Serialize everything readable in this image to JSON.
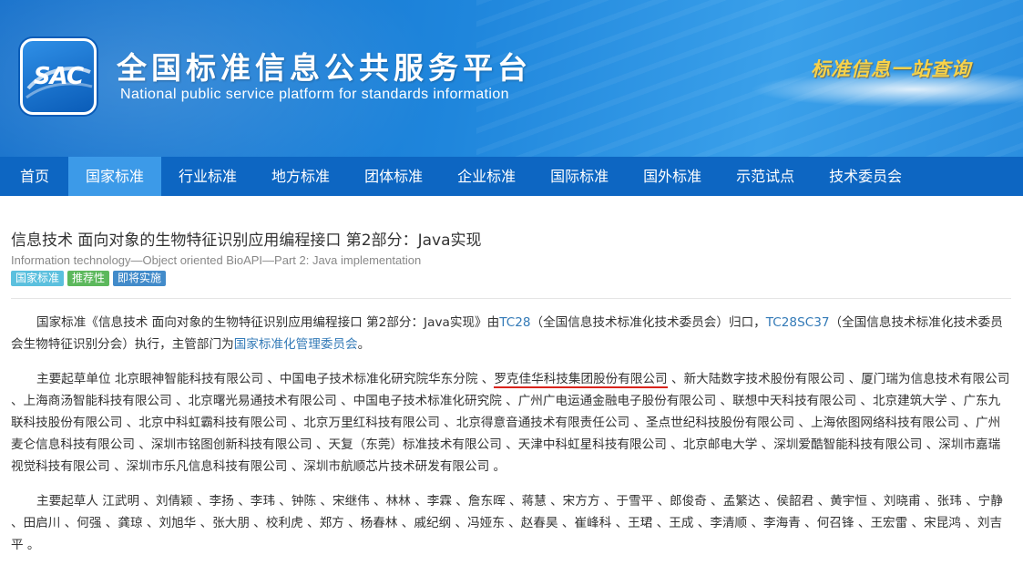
{
  "banner": {
    "logo_text": "SAC",
    "title_cn": "全国标准信息公共服务平台",
    "title_en": "National public service platform  for standards information",
    "slogan": "标准信息一站查询"
  },
  "nav": [
    "首页",
    "国家标准",
    "行业标准",
    "地方标准",
    "团体标准",
    "企业标准",
    "国际标准",
    "国外标准",
    "示范试点",
    "技术委员会"
  ],
  "standard": {
    "title_cn": "信息技术 面向对象的生物特征识别应用编程接口 第2部分：Java实现",
    "title_en": "Information technology—Object oriented BioAPI—Part 2: Java implementation",
    "badges": [
      "国家标准",
      "推荐性",
      "即将实施"
    ],
    "intro": {
      "p1": "国家标准《信息技术 面向对象的生物特征识别应用编程接口 第2部分：Java实现》由",
      "tc": "TC28",
      "p2": "（全国信息技术标准化技术委员会）归口，",
      "sc": "TC28SC37",
      "p3": "（全国信息技术标准化技术委员会生物特征识别分会）执行，主管部门为",
      "dept": "国家标准化管理委员会",
      "p4": "。"
    },
    "drafting_units": {
      "lead": "主要起草单位 北京眼神智能科技有限公司 、中国电子技术标准化研究院华东分院 、",
      "highlight": "罗克佳华科技集团股份有限公司",
      "rest": " 、新大陆数字技术股份有限公司 、厦门瑞为信息技术有限公司 、上海商汤智能科技有限公司 、北京曙光易通技术有限公司 、中国电子技术标准化研究院 、广州广电运通金融电子股份有限公司 、联想中天科技有限公司 、北京建筑大学 、广东九联科技股份有限公司 、北京中科虹霸科技有限公司 、北京万里红科技有限公司 、北京得意音通技术有限责任公司 、圣点世纪科技股份有限公司 、上海依图网络科技有限公司 、广州麦仑信息科技有限公司 、深圳市铭图创新科技有限公司 、天复（东莞）标准技术有限公司 、天津中科虹星科技有限公司 、北京邮电大学 、深圳爱酷智能科技有限公司 、深圳市嘉瑞视觉科技有限公司 、深圳市乐凡信息科技有限公司 、深圳市航顺芯片技术研发有限公司 。"
    },
    "drafters": "主要起草人 江武明 、刘倩颖 、李扬 、李玮 、钟陈 、宋继伟 、林林 、李霖 、詹东晖 、蒋慧 、宋方方 、于雪平 、郎俊奇 、孟繁达 、侯韶君 、黄宇恒 、刘晓甫 、张玮 、宁静 、田启川 、何强 、龚琼 、刘旭华 、张大朋 、校利虎 、郑方 、杨春林 、戚纪纲 、冯娅东 、赵春昊 、崔峰科 、王珺 、王成 、李清顺 、李海青 、何召锋 、王宏雷 、宋昆鸿 、刘吉平 。"
  },
  "colors": {
    "banner": "#1f86dc",
    "nav": "#0d66c2",
    "nav_active": "#3c9ae8",
    "link": "#337ab7",
    "highlight_underline": "#d9241c"
  }
}
